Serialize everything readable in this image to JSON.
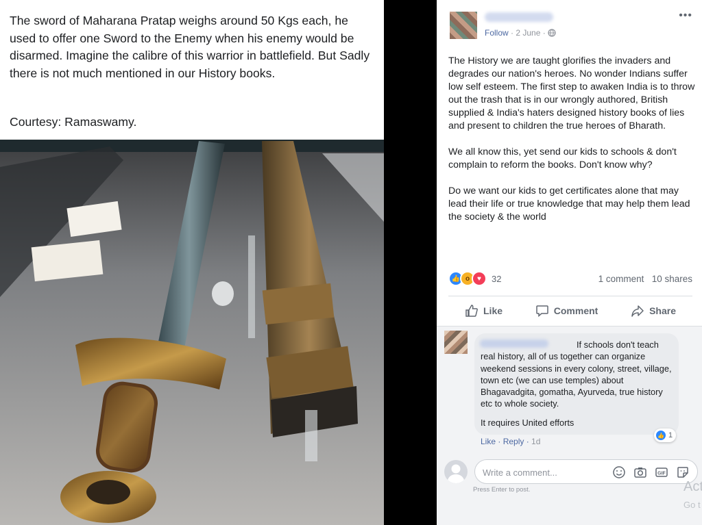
{
  "left_post": {
    "caption": "The sword of Maharana Pratap weighs around 50 Kgs each, he used to offer one Sword to the Enemy when his enemy would be disarmed. Imagine the calibre of this warrior in battlefield. But Sadly there is not much mentioned in our History books.",
    "courtesy": "Courtesy: Ramaswamy."
  },
  "post": {
    "follow": "Follow",
    "date": "· 2 June ·",
    "more": "•••",
    "text": "The History we are taught glorifies the invaders and degrades our nation's heroes. No wonder Indians suffer low self esteem. The first step to awaken India is to throw out the trash that is in our wrongly authored, British supplied & India's haters designed history books of lies and present to children the true heroes of Bharath.\n\nWe all know this, yet send our kids to schools & don't complain to reform the books. Don't know why?\n\nDo we want our kids to get certificates alone that may lead their life or true knowledge that may help them lead the society & the world",
    "reaction_count": "32",
    "comments_count": "1 comment",
    "shares_count": "10 shares",
    "actions": {
      "like": "Like",
      "comment": "Comment",
      "share": "Share"
    }
  },
  "comment": {
    "text": "If schools don't teach real history, all of us together can organize weekend sessions in every colony, street, village, town etc (we can use temples) about Bhagavadgita, gomatha, Ayurveda, true history etc to whole society.",
    "text2": "It requires United efforts",
    "reaction_count": "1",
    "like": "Like",
    "reply": "Reply",
    "time": "1d"
  },
  "composer": {
    "placeholder": "Write a comment...",
    "hint": "Press Enter to post."
  },
  "watermark": {
    "line1": "Act",
    "line2": "Go t"
  },
  "colors": {
    "link": "#4b67a1",
    "like_blue": "#2d88ff",
    "love_red": "#f33e58",
    "wow_yellow": "#f7b125"
  }
}
